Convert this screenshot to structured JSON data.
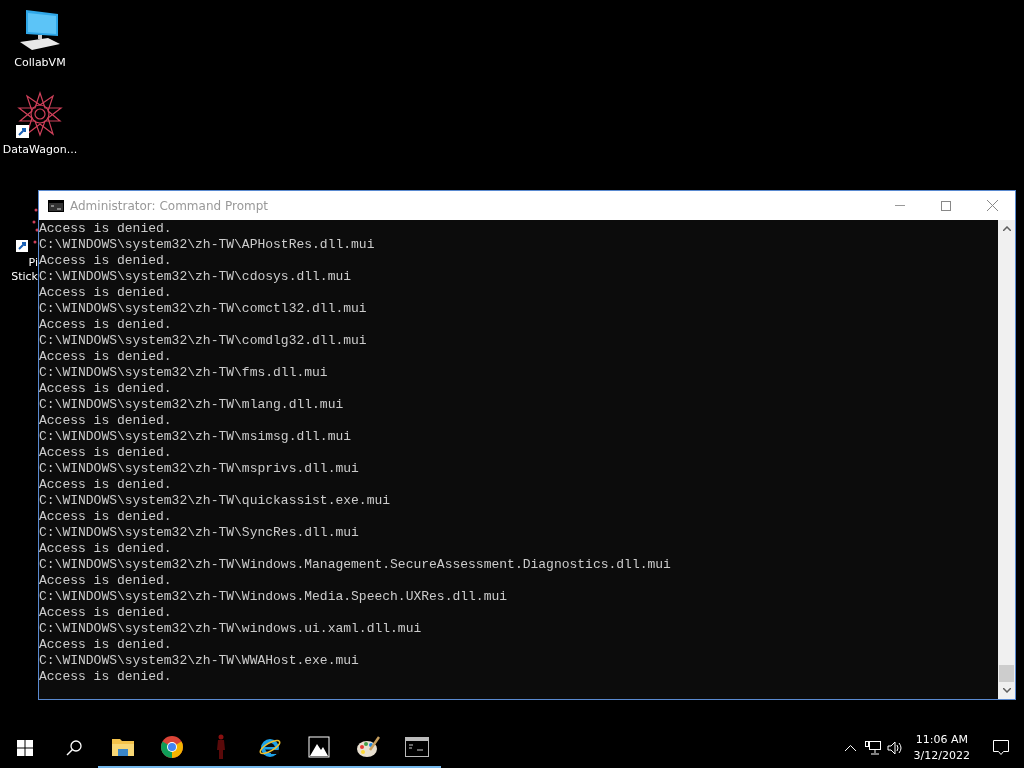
{
  "desktop_icons": [
    {
      "kind": "computer",
      "label": "CollabVM"
    },
    {
      "kind": "star",
      "label": "DataWagon..."
    }
  ],
  "partial_icon": {
    "label_lines": [
      "Pi",
      "Stick"
    ]
  },
  "window": {
    "title": "Administrator: Command Prompt",
    "lines": [
      "Access is denied.",
      "C:\\WINDOWS\\system32\\zh-TW\\APHostRes.dll.mui",
      "Access is denied.",
      "C:\\WINDOWS\\system32\\zh-TW\\cdosys.dll.mui",
      "Access is denied.",
      "C:\\WINDOWS\\system32\\zh-TW\\comctl32.dll.mui",
      "Access is denied.",
      "C:\\WINDOWS\\system32\\zh-TW\\comdlg32.dll.mui",
      "Access is denied.",
      "C:\\WINDOWS\\system32\\zh-TW\\fms.dll.mui",
      "Access is denied.",
      "C:\\WINDOWS\\system32\\zh-TW\\mlang.dll.mui",
      "Access is denied.",
      "C:\\WINDOWS\\system32\\zh-TW\\msimsg.dll.mui",
      "Access is denied.",
      "C:\\WINDOWS\\system32\\zh-TW\\msprivs.dll.mui",
      "Access is denied.",
      "C:\\WINDOWS\\system32\\zh-TW\\quickassist.exe.mui",
      "Access is denied.",
      "C:\\WINDOWS\\system32\\zh-TW\\SyncRes.dll.mui",
      "Access is denied.",
      "C:\\WINDOWS\\system32\\zh-TW\\Windows.Management.SecureAssessment.Diagnostics.dll.mui",
      "Access is denied.",
      "C:\\WINDOWS\\system32\\zh-TW\\Windows.Media.Speech.UXRes.dll.mui",
      "Access is denied.",
      "C:\\WINDOWS\\system32\\zh-TW\\windows.ui.xaml.dll.mui",
      "Access is denied.",
      "C:\\WINDOWS\\system32\\zh-TW\\WWAHost.exe.mui",
      "Access is denied."
    ]
  },
  "taskbar": {
    "apps": [
      {
        "kind": "explorer",
        "running": true
      },
      {
        "kind": "chrome",
        "running": true
      },
      {
        "kind": "figure",
        "running": true
      },
      {
        "kind": "ie",
        "running": true
      },
      {
        "kind": "photos",
        "running": true
      },
      {
        "kind": "paint",
        "running": true
      },
      {
        "kind": "cmd",
        "running": true
      }
    ],
    "time": "11:06 AM",
    "date": "3/12/2022"
  }
}
